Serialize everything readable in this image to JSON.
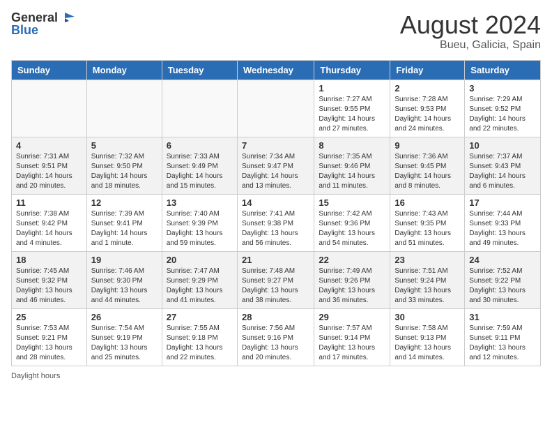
{
  "header": {
    "logo_general": "General",
    "logo_blue": "Blue",
    "month_year": "August 2024",
    "location": "Bueu, Galicia, Spain"
  },
  "days_of_week": [
    "Sunday",
    "Monday",
    "Tuesday",
    "Wednesday",
    "Thursday",
    "Friday",
    "Saturday"
  ],
  "weeks": [
    [
      {
        "day": "",
        "info": ""
      },
      {
        "day": "",
        "info": ""
      },
      {
        "day": "",
        "info": ""
      },
      {
        "day": "",
        "info": ""
      },
      {
        "day": "1",
        "info": "Sunrise: 7:27 AM\nSunset: 9:55 PM\nDaylight: 14 hours and 27 minutes."
      },
      {
        "day": "2",
        "info": "Sunrise: 7:28 AM\nSunset: 9:53 PM\nDaylight: 14 hours and 24 minutes."
      },
      {
        "day": "3",
        "info": "Sunrise: 7:29 AM\nSunset: 9:52 PM\nDaylight: 14 hours and 22 minutes."
      }
    ],
    [
      {
        "day": "4",
        "info": "Sunrise: 7:31 AM\nSunset: 9:51 PM\nDaylight: 14 hours and 20 minutes."
      },
      {
        "day": "5",
        "info": "Sunrise: 7:32 AM\nSunset: 9:50 PM\nDaylight: 14 hours and 18 minutes."
      },
      {
        "day": "6",
        "info": "Sunrise: 7:33 AM\nSunset: 9:49 PM\nDaylight: 14 hours and 15 minutes."
      },
      {
        "day": "7",
        "info": "Sunrise: 7:34 AM\nSunset: 9:47 PM\nDaylight: 14 hours and 13 minutes."
      },
      {
        "day": "8",
        "info": "Sunrise: 7:35 AM\nSunset: 9:46 PM\nDaylight: 14 hours and 11 minutes."
      },
      {
        "day": "9",
        "info": "Sunrise: 7:36 AM\nSunset: 9:45 PM\nDaylight: 14 hours and 8 minutes."
      },
      {
        "day": "10",
        "info": "Sunrise: 7:37 AM\nSunset: 9:43 PM\nDaylight: 14 hours and 6 minutes."
      }
    ],
    [
      {
        "day": "11",
        "info": "Sunrise: 7:38 AM\nSunset: 9:42 PM\nDaylight: 14 hours and 4 minutes."
      },
      {
        "day": "12",
        "info": "Sunrise: 7:39 AM\nSunset: 9:41 PM\nDaylight: 14 hours and 1 minute."
      },
      {
        "day": "13",
        "info": "Sunrise: 7:40 AM\nSunset: 9:39 PM\nDaylight: 13 hours and 59 minutes."
      },
      {
        "day": "14",
        "info": "Sunrise: 7:41 AM\nSunset: 9:38 PM\nDaylight: 13 hours and 56 minutes."
      },
      {
        "day": "15",
        "info": "Sunrise: 7:42 AM\nSunset: 9:36 PM\nDaylight: 13 hours and 54 minutes."
      },
      {
        "day": "16",
        "info": "Sunrise: 7:43 AM\nSunset: 9:35 PM\nDaylight: 13 hours and 51 minutes."
      },
      {
        "day": "17",
        "info": "Sunrise: 7:44 AM\nSunset: 9:33 PM\nDaylight: 13 hours and 49 minutes."
      }
    ],
    [
      {
        "day": "18",
        "info": "Sunrise: 7:45 AM\nSunset: 9:32 PM\nDaylight: 13 hours and 46 minutes."
      },
      {
        "day": "19",
        "info": "Sunrise: 7:46 AM\nSunset: 9:30 PM\nDaylight: 13 hours and 44 minutes."
      },
      {
        "day": "20",
        "info": "Sunrise: 7:47 AM\nSunset: 9:29 PM\nDaylight: 13 hours and 41 minutes."
      },
      {
        "day": "21",
        "info": "Sunrise: 7:48 AM\nSunset: 9:27 PM\nDaylight: 13 hours and 38 minutes."
      },
      {
        "day": "22",
        "info": "Sunrise: 7:49 AM\nSunset: 9:26 PM\nDaylight: 13 hours and 36 minutes."
      },
      {
        "day": "23",
        "info": "Sunrise: 7:51 AM\nSunset: 9:24 PM\nDaylight: 13 hours and 33 minutes."
      },
      {
        "day": "24",
        "info": "Sunrise: 7:52 AM\nSunset: 9:22 PM\nDaylight: 13 hours and 30 minutes."
      }
    ],
    [
      {
        "day": "25",
        "info": "Sunrise: 7:53 AM\nSunset: 9:21 PM\nDaylight: 13 hours and 28 minutes."
      },
      {
        "day": "26",
        "info": "Sunrise: 7:54 AM\nSunset: 9:19 PM\nDaylight: 13 hours and 25 minutes."
      },
      {
        "day": "27",
        "info": "Sunrise: 7:55 AM\nSunset: 9:18 PM\nDaylight: 13 hours and 22 minutes."
      },
      {
        "day": "28",
        "info": "Sunrise: 7:56 AM\nSunset: 9:16 PM\nDaylight: 13 hours and 20 minutes."
      },
      {
        "day": "29",
        "info": "Sunrise: 7:57 AM\nSunset: 9:14 PM\nDaylight: 13 hours and 17 minutes."
      },
      {
        "day": "30",
        "info": "Sunrise: 7:58 AM\nSunset: 9:13 PM\nDaylight: 13 hours and 14 minutes."
      },
      {
        "day": "31",
        "info": "Sunrise: 7:59 AM\nSunset: 9:11 PM\nDaylight: 13 hours and 12 minutes."
      }
    ]
  ],
  "footer": {
    "daylight_label": "Daylight hours"
  }
}
